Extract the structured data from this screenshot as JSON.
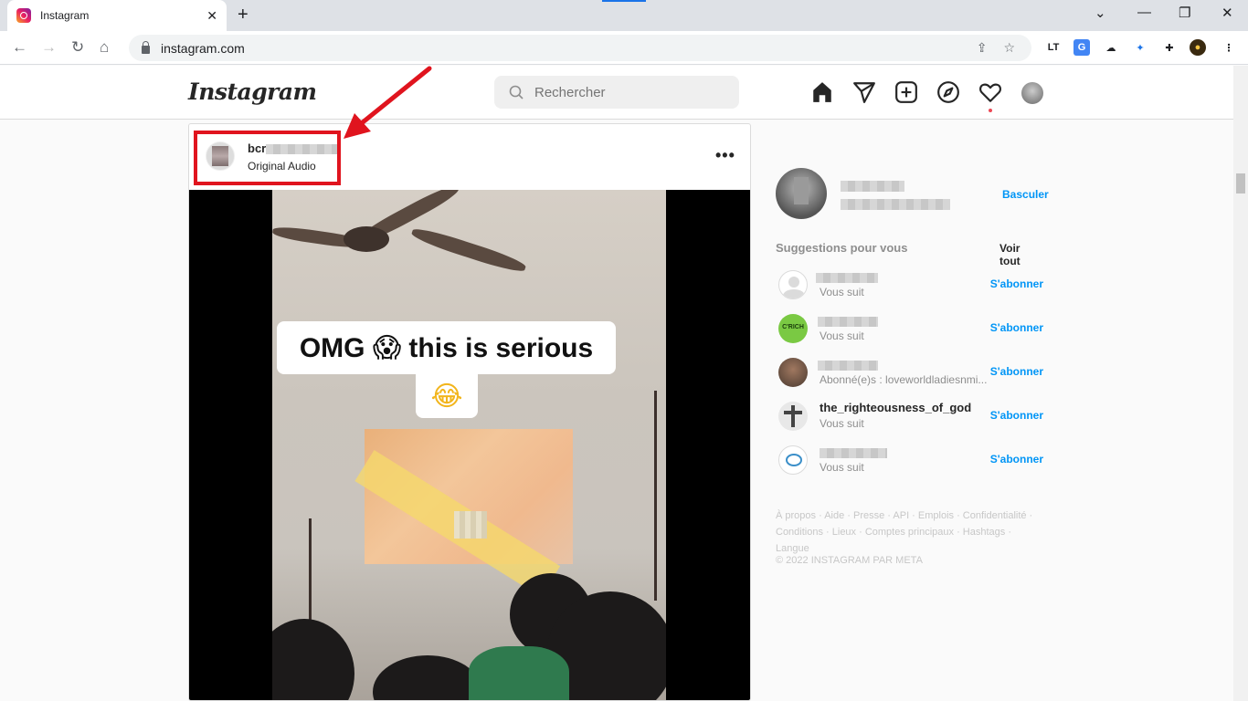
{
  "browser": {
    "tab_title": "Instagram",
    "tab_close": "✕",
    "new_tab": "+",
    "url": "instagram.com",
    "controls": {
      "minimize": "⌄",
      "minimize2": "—",
      "restore": "❐",
      "close": "✕"
    },
    "extensions": [
      "LT",
      "G",
      "cloud",
      "puzzle-blue",
      "puzzle",
      "profile"
    ]
  },
  "ig": {
    "logo": "Instagram",
    "search_placeholder": "Rechercher",
    "nav_icons": [
      "home-icon",
      "direct-icon",
      "new-post-icon",
      "explore-icon",
      "activity-icon",
      "profile-icon"
    ]
  },
  "post": {
    "username_visible": "bcr",
    "audio": "Original Audio",
    "more": "•••",
    "caption_line1": "OMG 😱 this is serious",
    "caption_line2": "😂"
  },
  "sidebar": {
    "switch": "Basculer",
    "suggestions_title": "Suggestions pour vous",
    "see_all": "Voir tout",
    "items": [
      {
        "name": "",
        "sub": "Vous suit",
        "action": "S'abonner",
        "avatar": "default"
      },
      {
        "name": "",
        "sub": "Vous suit",
        "action": "S'abonner",
        "avatar": "green"
      },
      {
        "name": "",
        "sub": "Abonné(e)s : loveworldladiesnmi...",
        "action": "S'abonner",
        "avatar": "photo"
      },
      {
        "name": "the_righteousness_of_god",
        "sub": "Vous suit",
        "action": "S'abonner",
        "avatar": "cross"
      },
      {
        "name": "",
        "sub": "Vous suit",
        "action": "S'abonner",
        "avatar": "logo"
      }
    ],
    "footer": "À propos · Aide · Presse · API · Emplois · Confidentialité · Conditions · Lieux · Comptes principaux · Hashtags · Langue",
    "copyright": "© 2022 INSTAGRAM PAR META"
  },
  "colors": {
    "accent": "#0095f6",
    "highlight": "#e0141e",
    "text": "#262626"
  }
}
